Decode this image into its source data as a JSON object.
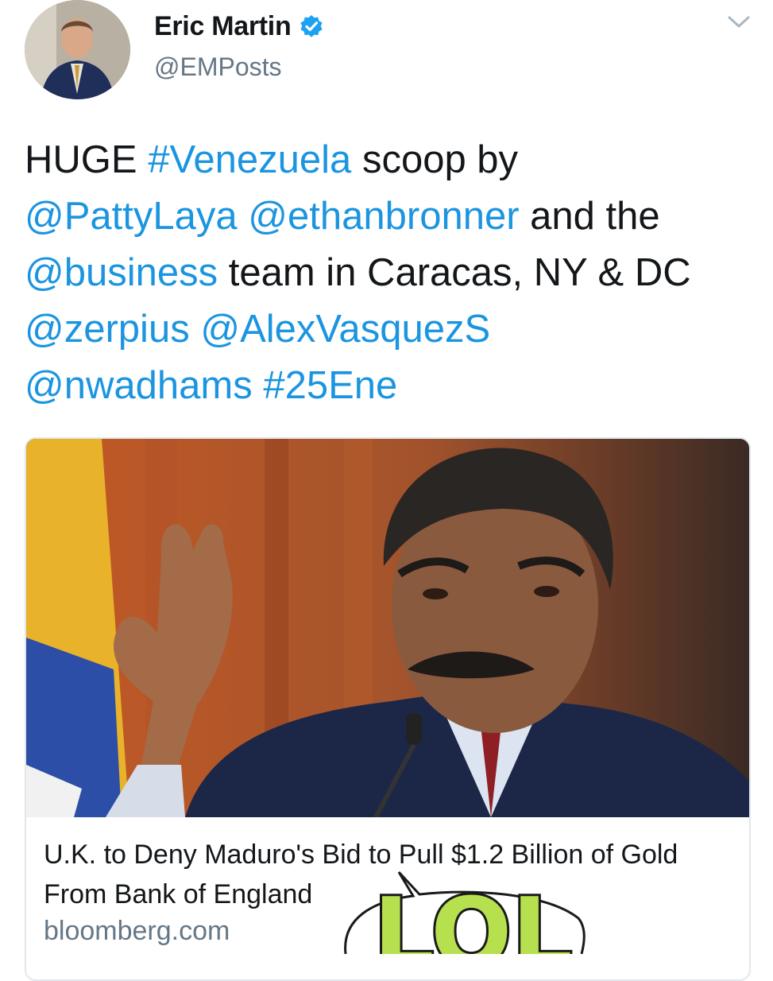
{
  "user": {
    "name": "Eric Martin",
    "handle": "@EMPosts",
    "verified": true
  },
  "tweet": {
    "segments": [
      {
        "text": "HUGE ",
        "type": "text"
      },
      {
        "text": "#Venezuela",
        "type": "hashtag"
      },
      {
        "text": " scoop by ",
        "type": "text"
      },
      {
        "text": "@PattyLaya",
        "type": "mention"
      },
      {
        "text": " ",
        "type": "text"
      },
      {
        "text": "@ethanbronner",
        "type": "mention"
      },
      {
        "text": " and the ",
        "type": "text"
      },
      {
        "text": "@business",
        "type": "mention"
      },
      {
        "text": " team in Caracas, NY & DC ",
        "type": "text"
      },
      {
        "text": "@zerpius",
        "type": "mention"
      },
      {
        "text": " ",
        "type": "text"
      },
      {
        "text": "@AlexVasquezS",
        "type": "mention"
      },
      {
        "text": " ",
        "type": "text"
      },
      {
        "text": "@nwadhams",
        "type": "mention"
      },
      {
        "text": " ",
        "type": "text"
      },
      {
        "text": "#25Ene",
        "type": "hashtag"
      }
    ]
  },
  "card": {
    "title": "U.K. to Deny Maduro's Bid to Pull $1.2 Billion of Gold From Bank of England",
    "domain": "bloomberg.com"
  },
  "sticker": {
    "text": "LOL"
  },
  "icons": {
    "verified": "verified-badge-icon",
    "menu": "chevron-down-icon"
  },
  "colors": {
    "link": "#1b95e0",
    "text": "#14171a",
    "secondary": "#657786",
    "verified": "#1da1f2"
  }
}
